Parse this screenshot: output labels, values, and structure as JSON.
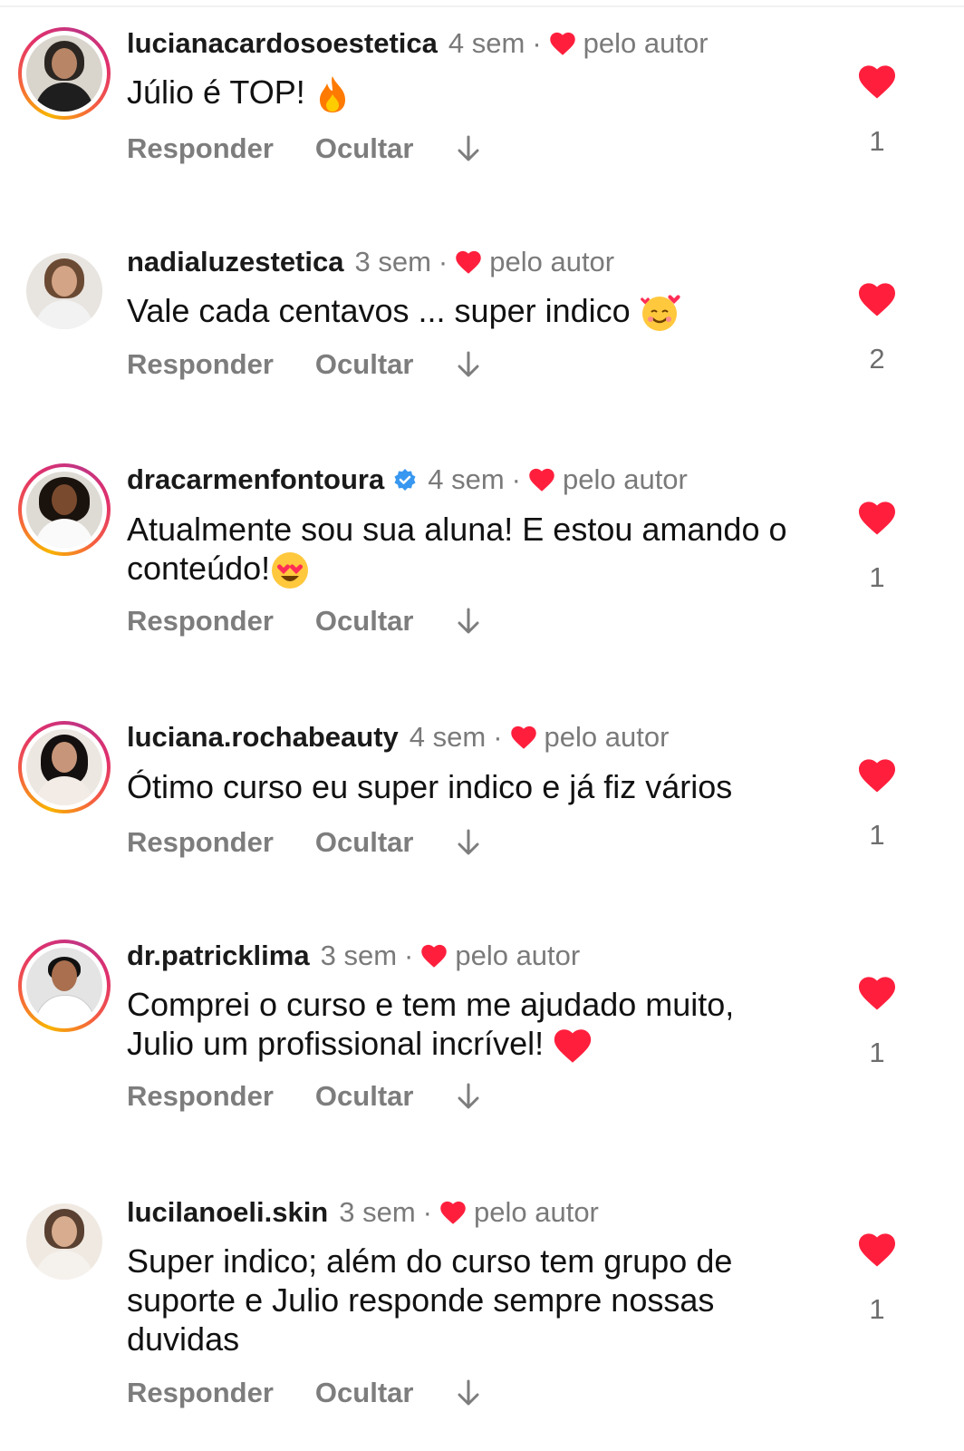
{
  "by_author_label": "pelo autor",
  "actions": {
    "reply": "Responder",
    "hide": "Ocultar"
  },
  "colors": {
    "heart": "#ff1f3d",
    "verified": "#3897f0",
    "muted": "#7d7d7d"
  },
  "icons": {
    "like": "heart-icon",
    "more": "arrow-down-icon",
    "verified": "verified-badge-icon"
  },
  "comments": [
    {
      "username": "lucianacardosoestetica",
      "time": "4 sem",
      "text": "Júlio é TOP!",
      "emoji": "fire-emoji",
      "likes": "1",
      "story_ring": true,
      "verified": false
    },
    {
      "username": "nadialuzestetica",
      "time": "3 sem",
      "text": "Vale cada centavos ... super indico",
      "emoji": "smiling-face-with-hearts-emoji",
      "likes": "2",
      "story_ring": false,
      "verified": false
    },
    {
      "username": "dracarmenfontoura",
      "time": "4 sem",
      "text": "Atualmente sou sua aluna! E estou amando o conteúdo!",
      "emoji": "heart-eyes-emoji",
      "likes": "1",
      "story_ring": true,
      "verified": true
    },
    {
      "username": "luciana.rochabeauty",
      "time": "4 sem",
      "text": "Ótimo curso eu super indico e já fiz vários",
      "emoji": "",
      "likes": "1",
      "story_ring": true,
      "verified": false
    },
    {
      "username": "dr.patricklima",
      "time": "3 sem",
      "text": "Comprei o curso e tem me ajudado muito, Julio um profissional incrível!",
      "emoji": "red-heart-emoji",
      "likes": "1",
      "story_ring": true,
      "verified": false
    },
    {
      "username": "lucilanoeli.skin",
      "time": "3 sem",
      "text": "Super indico; além do curso tem grupo de suporte  e Julio responde sempre nossas duvidas",
      "emoji": "",
      "likes": "1",
      "story_ring": false,
      "verified": false
    }
  ]
}
